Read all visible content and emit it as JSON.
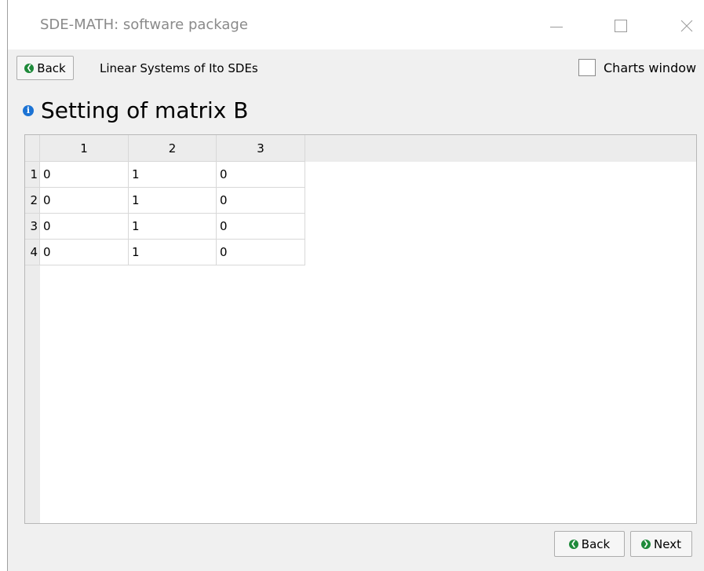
{
  "window": {
    "title": "SDE-MATH: software package"
  },
  "toolbar": {
    "back_label": "Back",
    "subtitle": "Linear Systems of Ito SDEs",
    "charts_label": "Charts window"
  },
  "heading": {
    "text": "Setting of matrix B"
  },
  "table": {
    "columns": [
      "1",
      "2",
      "3"
    ],
    "rows": [
      {
        "label": "1",
        "cells": [
          "0",
          "1",
          "0"
        ]
      },
      {
        "label": "2",
        "cells": [
          "0",
          "1",
          "0"
        ]
      },
      {
        "label": "3",
        "cells": [
          "0",
          "1",
          "0"
        ]
      },
      {
        "label": "4",
        "cells": [
          "0",
          "1",
          "0"
        ]
      }
    ]
  },
  "footer": {
    "back_label": "Back",
    "next_label": "Next"
  },
  "icons": {
    "back": "arrow-left-circle-icon",
    "next": "arrow-right-circle-icon",
    "info": "info-icon"
  },
  "colors": {
    "accent_green": "#1e8a3a",
    "info_blue": "#1c73d4"
  }
}
